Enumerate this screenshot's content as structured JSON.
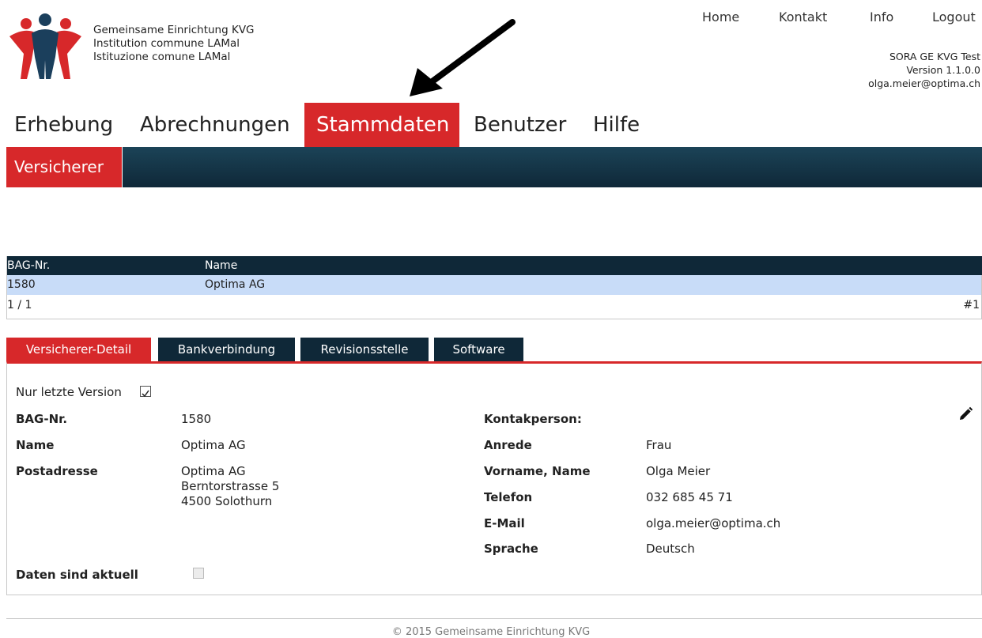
{
  "header": {
    "org_lines": [
      "Gemeinsame Einrichtung KVG",
      "Institution commune LAMal",
      "Istituzione comune LAMal"
    ],
    "top_nav": [
      "Home",
      "Kontakt",
      "Info",
      "Logout"
    ],
    "app_name": "SORA GE KVG Test",
    "version": "Version 1.1.0.0",
    "user_email": "olga.meier@optima.ch"
  },
  "main_nav": {
    "items": [
      "Erhebung",
      "Abrechnungen",
      "Stammdaten",
      "Benutzer",
      "Hilfe"
    ],
    "active": "Stammdaten"
  },
  "sub_nav": {
    "active": "Versicherer"
  },
  "grid": {
    "columns": [
      "BAG-Nr.",
      "Name"
    ],
    "rows": [
      {
        "bag_nr": "1580",
        "name": "Optima AG"
      }
    ],
    "pager": "1  / 1",
    "count": "#1"
  },
  "tabs": {
    "items": [
      "Versicherer-Detail",
      "Bankverbindung",
      "Revisionsstelle",
      "Software"
    ],
    "active": "Versicherer-Detail"
  },
  "detail": {
    "only_last_version_label": "Nur letzte Version",
    "only_last_version_checked": true,
    "bag_nr_label": "BAG-Nr.",
    "bag_nr": "1580",
    "name_label": "Name",
    "name": "Optima AG",
    "postal_label": "Postadresse",
    "postal_lines": [
      "Optima AG",
      "Berntorstrasse 5",
      "4500 Solothurn"
    ],
    "data_current_label": "Daten sind aktuell",
    "data_current_checked": false,
    "contact_label": "Kontakperson:",
    "salutation_label": "Anrede",
    "salutation": "Frau",
    "fullname_label": "Vorname, Name",
    "fullname": "Olga Meier",
    "phone_label": "Telefon",
    "phone": "032 685 45 71",
    "email_label": "E-Mail",
    "email": "olga.meier@optima.ch",
    "language_label": "Sprache",
    "language": "Deutsch"
  },
  "footer": {
    "copyright": "© 2015 Gemeinsame Einrichtung KVG"
  },
  "colors": {
    "accent_red": "#d7282a",
    "dark_navy": "#0f2838",
    "row_highlight": "#c8dcf8"
  },
  "icons": [
    "logo-figures-icon",
    "pencil-edit-icon",
    "checkbox-checked-icon",
    "annotation-arrow-icon"
  ]
}
